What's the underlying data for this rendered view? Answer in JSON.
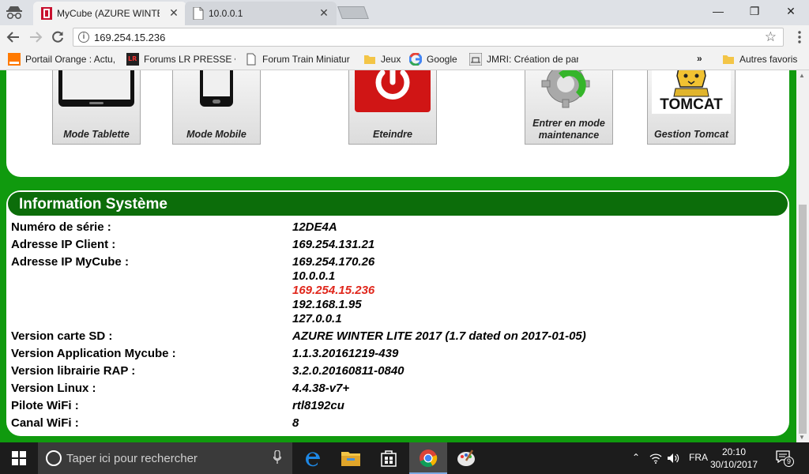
{
  "browser": {
    "tabs": [
      {
        "title": "MyCube (AZURE WINTER",
        "active": true
      },
      {
        "title": "10.0.0.1",
        "active": false
      }
    ],
    "url": "169.254.15.236",
    "window_controls": {
      "minimize": "—",
      "maximize": "❐",
      "close": "✕"
    },
    "bookmarks": [
      {
        "label": "Portail Orange : Actu,",
        "icon": "orange-icon"
      },
      {
        "label": "Forums LR PRESSE •",
        "icon": "lr-presse-icon"
      },
      {
        "label": "Forum Train Miniatur",
        "icon": "page-icon"
      },
      {
        "label": "Jeux",
        "icon": "folder-icon"
      },
      {
        "label": "Google",
        "icon": "google-icon"
      },
      {
        "label": "JMRI: Création de par",
        "icon": "jmri-icon"
      }
    ],
    "bookmarks_overflow": "»",
    "other_bookmarks": "Autres favoris"
  },
  "tiles": [
    {
      "label": "Mode Tablette",
      "icon": "tablet-icon"
    },
    {
      "label": "Mode Mobile",
      "icon": "mobile-icon"
    },
    {
      "label": "Eteindre",
      "icon": "power-icon"
    },
    {
      "label": "Entrer en mode maintenance",
      "icon": "maintenance-gear-icon"
    },
    {
      "label": "Gestion Tomcat",
      "icon": "tomcat-icon",
      "logo_text": "TOMCAT"
    }
  ],
  "info": {
    "title": "Information Système",
    "serial_label": "Numéro de série :",
    "serial_value": "12DE4A",
    "client_ip_label": "Adresse IP Client :",
    "client_ip_value": "169.254.131.21",
    "mycube_ip_label": "Adresse IP MyCube :",
    "mycube_ips": [
      "169.254.170.26",
      "10.0.0.1",
      "169.254.15.236",
      "192.168.1.95",
      "127.0.0.1"
    ],
    "sd_label": "Version carte SD :",
    "sd_value": "AZURE WINTER LITE 2017 (1.7 dated on 2017-01-05)",
    "app_label": "Version Application Mycube :",
    "app_value": "1.1.3.20161219-439",
    "rap_label": "Version librairie RAP :",
    "rap_value": "3.2.0.20160811-0840",
    "linux_label": "Version Linux :",
    "linux_value": "4.4.38-v7+",
    "wifi_driver_label": "Pilote WiFi :",
    "wifi_driver_value": "rtl8192cu",
    "wifi_channel_label": "Canal WiFi :",
    "wifi_channel_value": "8",
    "highlight_color": "#e0271c"
  },
  "taskbar": {
    "search_placeholder": "Taper ici pour rechercher",
    "language": "FRA",
    "time": "20:10",
    "date": "30/10/2017",
    "notification_count": "9"
  }
}
